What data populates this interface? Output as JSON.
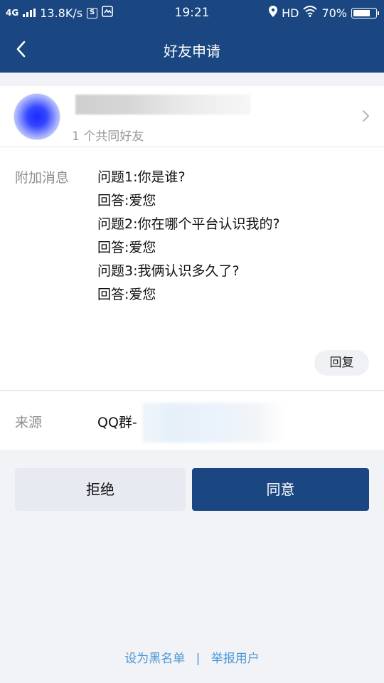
{
  "status_bar": {
    "network": "4G",
    "speed": "13.8K/s",
    "time": "19:21",
    "hd": "HD",
    "battery": "70%"
  },
  "nav": {
    "title": "好友申请"
  },
  "profile": {
    "mutual_friends": "1 个共同好友"
  },
  "message": {
    "label": "附加消息",
    "lines": [
      "问题1:你是谁?",
      "回答:爱您",
      "问题2:你在哪个平台认识我的?",
      "回答:爱您",
      "问题3:我俩认识多久了?",
      "回答:爱您"
    ],
    "reply_label": "回复"
  },
  "source": {
    "label": "来源",
    "value": "QQ群-"
  },
  "actions": {
    "reject": "拒绝",
    "accept": "同意"
  },
  "footer": {
    "blacklist": "设为黑名单",
    "separator": "|",
    "report": "举报用户"
  },
  "colors": {
    "header": "#1a4781",
    "accept_bg": "#1a4781",
    "reject_bg": "#e7eaf0",
    "link": "#4a97d6"
  }
}
